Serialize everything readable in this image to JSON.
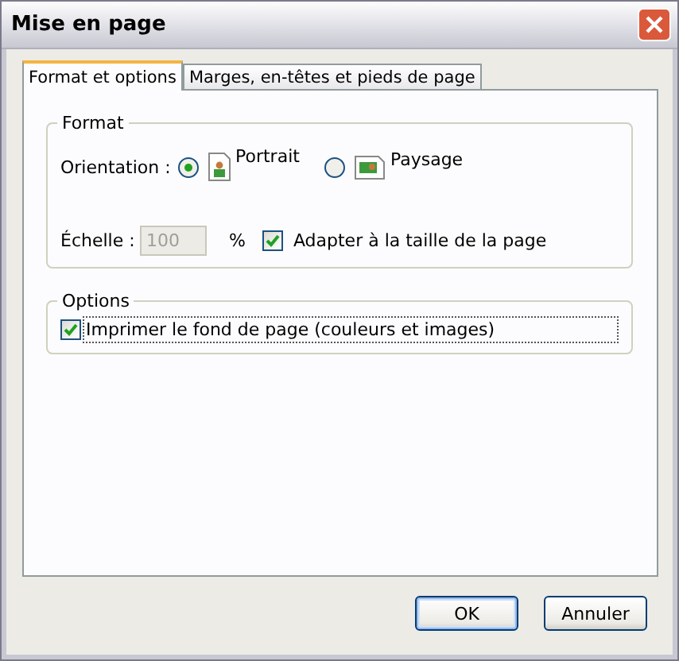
{
  "window": {
    "title": "Mise en page"
  },
  "tabs": [
    {
      "label": "Format et options",
      "selected": true
    },
    {
      "label": "Marges, en-têtes et pieds de page",
      "selected": false
    }
  ],
  "format": {
    "legend": "Format",
    "orientation_label": "Orientation :",
    "orientations": [
      {
        "label": "Portrait",
        "kind": "portrait",
        "selected": true
      },
      {
        "label": "Paysage",
        "kind": "landscape",
        "selected": false
      }
    ],
    "scale_label": "Échelle :",
    "scale": {
      "value": "100",
      "disabled": true
    },
    "scale_unit": "%",
    "fit": {
      "label": "Adapter à la taille de la page",
      "checked": true
    }
  },
  "options": {
    "legend": "Options",
    "print_background": {
      "label": "Imprimer le fond de page (couleurs et images)",
      "checked": true,
      "focused": true
    }
  },
  "buttons": [
    {
      "label": "OK",
      "default": true
    },
    {
      "label": "Annuler",
      "default": false
    }
  ]
}
